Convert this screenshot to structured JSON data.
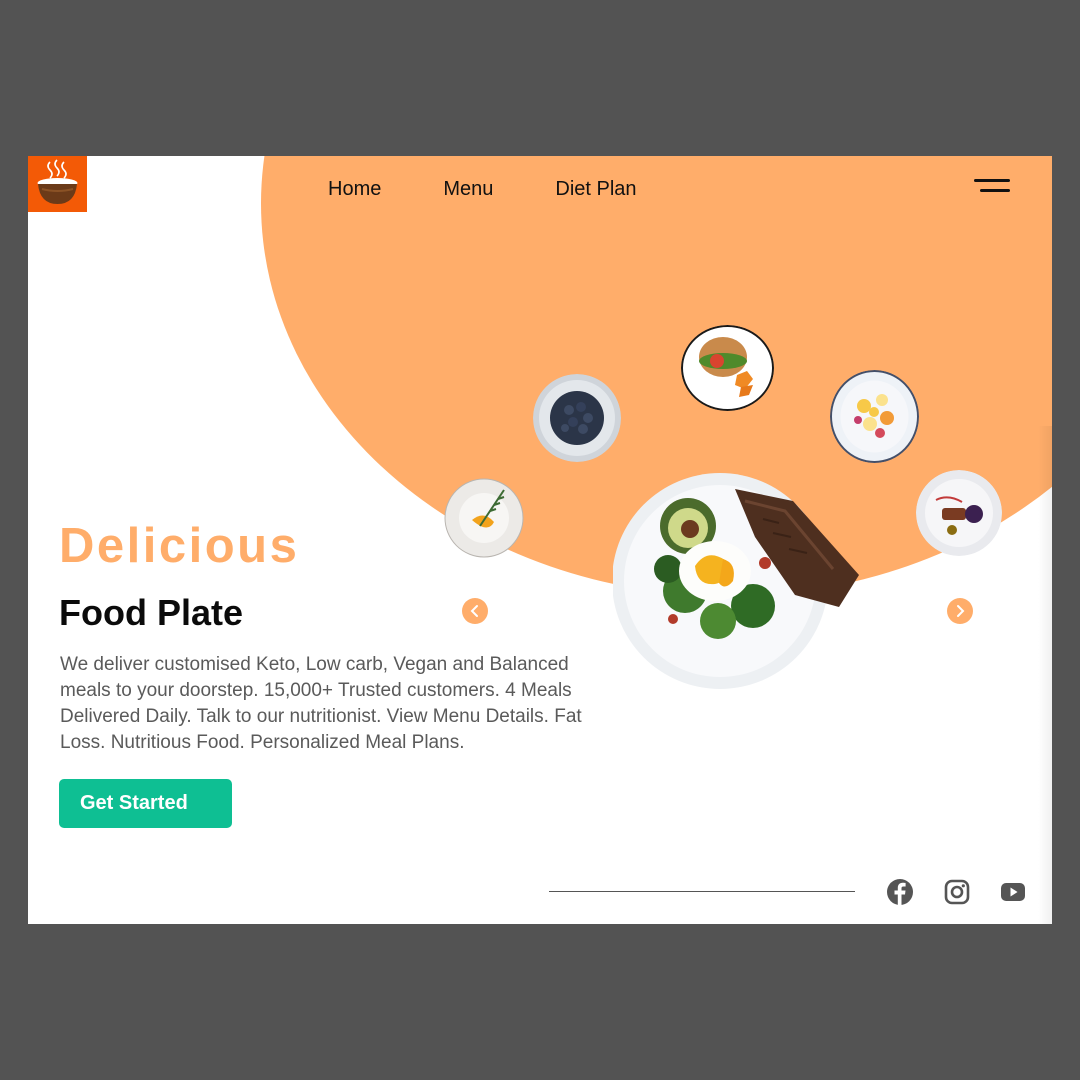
{
  "nav": {
    "items": [
      {
        "label": "Home"
      },
      {
        "label": "Menu"
      },
      {
        "label": "Diet Plan"
      }
    ]
  },
  "hero": {
    "kicker": "Delicious",
    "title": "Food Plate",
    "description": "We deliver customised Keto, Low carb, Vegan and Balanced meals to your doorstep. 15,000+ Trusted customers. 4 Meals Delivered Daily. Talk to our nutritionist. View Menu Details. Fat Loss. Nutritious Food. Personalized Meal Plans.",
    "cta_label": "Get Started"
  },
  "icons": {
    "logo": "steaming-bowl-icon",
    "menu": "hamburger-menu-icon",
    "prev": "chevron-left-icon",
    "next": "chevron-right-icon",
    "social": [
      "facebook-icon",
      "instagram-icon",
      "youtube-icon"
    ]
  },
  "colors": {
    "accent": "#ffad6a",
    "brand": "#f35a06",
    "cta": "#0ebf93",
    "background": "#535353"
  }
}
